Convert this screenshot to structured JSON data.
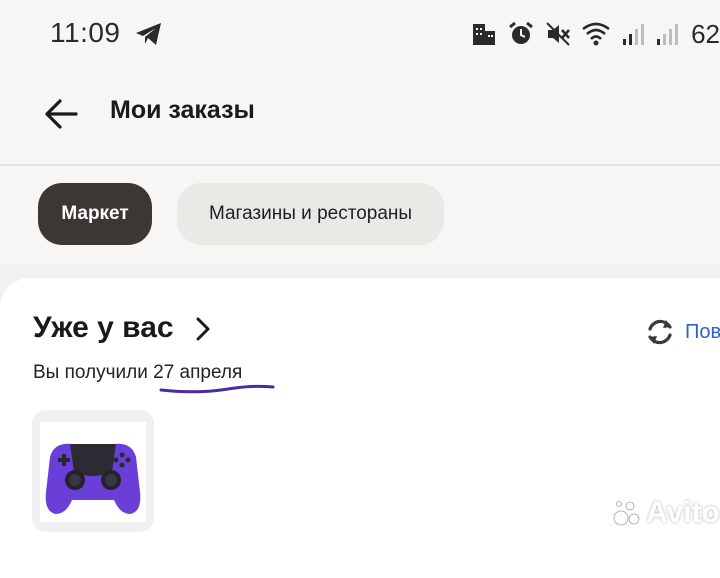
{
  "status_bar": {
    "time": "11:09",
    "battery_text": "62",
    "icons": [
      "telegram-icon",
      "building-icon",
      "alarm-icon",
      "mute-icon",
      "wifi-icon",
      "signal-icon"
    ]
  },
  "header": {
    "title": "Мои заказы",
    "back_icon": "arrow-left-icon"
  },
  "tabs": [
    {
      "label": "Маркет",
      "active": true
    },
    {
      "label": "Магазины и рестораны",
      "active": false
    }
  ],
  "order": {
    "title": "Уже у вас",
    "subtitle_prefix": "Вы получили ",
    "subtitle_date": "27 апреля",
    "repeat_label": "Пов",
    "product_image": "purple-gamepad"
  },
  "watermark": {
    "text": "Avito"
  },
  "colors": {
    "active_tab": "#3b3834",
    "inactive_tab": "#ebe9e5",
    "link_blue": "#2f5fd6",
    "underline_purple": "#4b2aa8",
    "controller_purple": "#6a3fd8"
  }
}
